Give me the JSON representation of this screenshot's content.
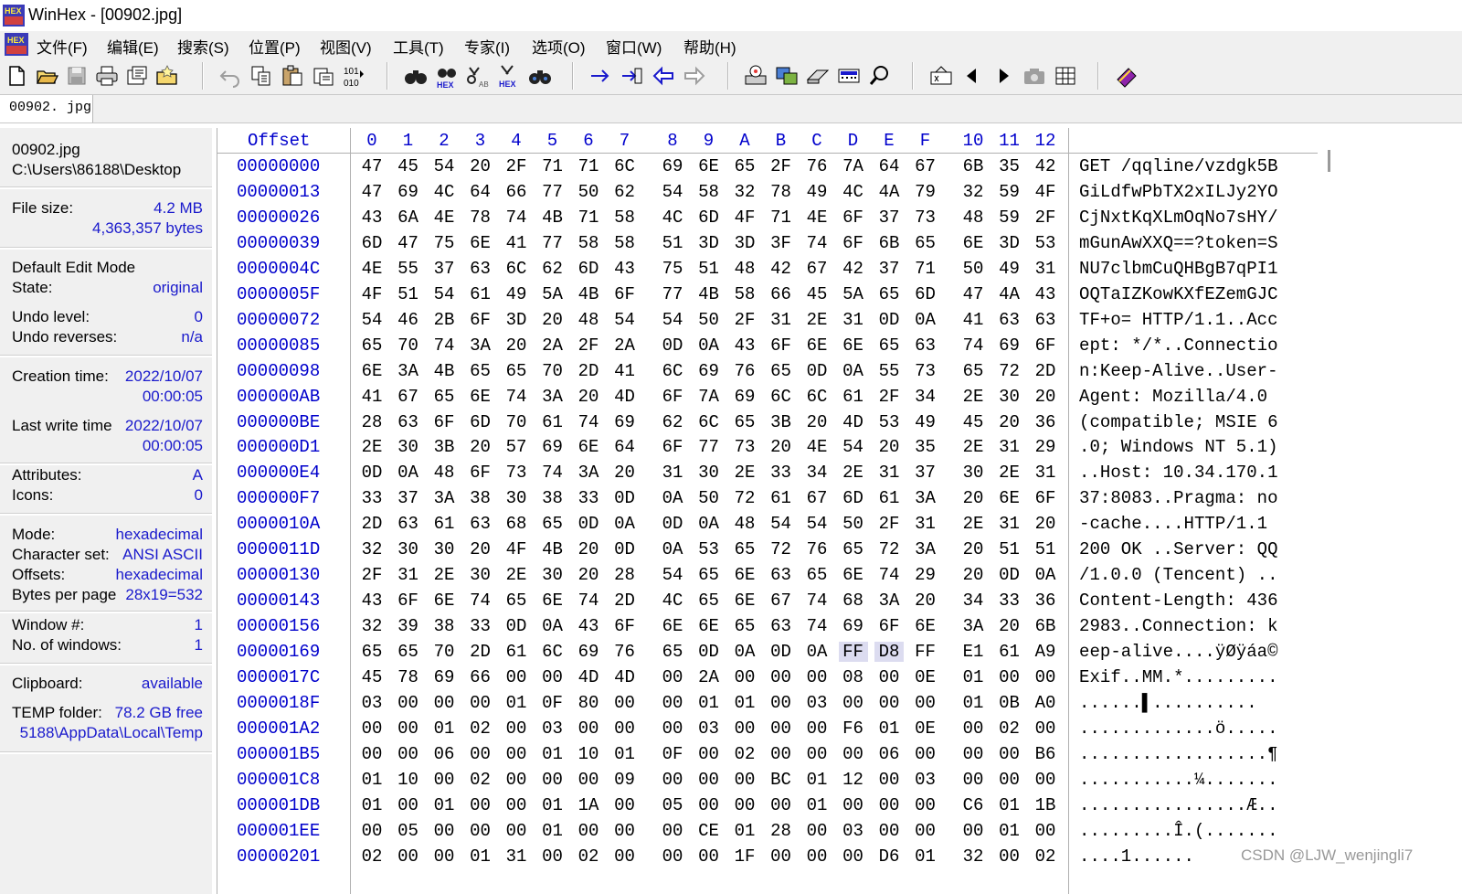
{
  "window": {
    "title": "WinHex - [00902.jpg]"
  },
  "menu": [
    "文件(F)",
    "编辑(E)",
    "搜索(S)",
    "位置(P)",
    "视图(V)",
    "工具(T)",
    "专家(I)",
    "选项(O)",
    "窗口(W)",
    "帮助(H)"
  ],
  "toolbar_icons": [
    "new-file-icon",
    "open-file-icon",
    "save-icon",
    "print-icon",
    "properties-icon",
    "open-folder-icon",
    "undo-icon",
    "copy-icon",
    "paste-icon",
    "clipboard-icon",
    "binary-icon",
    "find-text-icon",
    "find-hex-icon",
    "replace-text-icon",
    "replace-hex-icon",
    "find-again-icon",
    "goto-offset-icon",
    "goto-position-icon",
    "back-icon",
    "forward-icon",
    "disk-editor-icon",
    "ram-editor-icon",
    "disk-icon",
    "calculator-icon",
    "zoom-search-icon",
    "record-presentation-icon",
    "previous-icon",
    "next-icon",
    "camera-icon",
    "grid-view-icon",
    "help-book-icon"
  ],
  "tab": {
    "label": "00902. jpg"
  },
  "info": {
    "filename": "00902.jpg",
    "path": "C:\\Users\\86188\\Desktop",
    "file_size_label": "File size:",
    "file_size_mb": "4.2 MB",
    "file_size_bytes": "4,363,357 bytes",
    "edit_mode_label": "Default Edit Mode",
    "state_label": "State:",
    "state_value": "original",
    "undo_level_label": "Undo level:",
    "undo_level_value": "0",
    "undo_reverses_label": "Undo reverses:",
    "undo_reverses_value": "n/a",
    "creation_label": "Creation time:",
    "creation_date": "2022/10/07",
    "creation_time": "00:00:05",
    "lastwrite_label": "Last write time",
    "lastwrite_date": "2022/10/07",
    "lastwrite_time": "00:00:05",
    "attributes_label": "Attributes:",
    "attributes_value": "A",
    "icons_label": "Icons:",
    "icons_value": "0",
    "mode_label": "Mode:",
    "mode_value": "hexadecimal",
    "charset_label": "Character set:",
    "charset_value": "ANSI ASCII",
    "offsets_label": "Offsets:",
    "offsets_value": "hexadecimal",
    "bpp_label": "Bytes per page",
    "bpp_value": "28x19=532",
    "window_no_label": "Window #:",
    "window_no_value": "1",
    "windows_count_label": "No. of windows:",
    "windows_count_value": "1",
    "clipboard_label": "Clipboard:",
    "clipboard_value": "available",
    "temp_label": "TEMP folder:",
    "temp_value": "78.2 GB free",
    "temp_path": "5188\\AppData\\Local\\Temp"
  },
  "hex": {
    "offset_header": "Offset",
    "columns": [
      "0",
      "1",
      "2",
      "3",
      "4",
      "5",
      "6",
      "7",
      "8",
      "9",
      "A",
      "B",
      "C",
      "D",
      "E",
      "F",
      "10",
      "11",
      "12"
    ],
    "rows": [
      {
        "offset": "00000000",
        "bytes": [
          "47",
          "45",
          "54",
          "20",
          "2F",
          "71",
          "71",
          "6C",
          "69",
          "6E",
          "65",
          "2F",
          "76",
          "7A",
          "64",
          "67",
          "6B",
          "35",
          "42"
        ],
        "text": "GET /qqline/vzdgk5B"
      },
      {
        "offset": "00000013",
        "bytes": [
          "47",
          "69",
          "4C",
          "64",
          "66",
          "77",
          "50",
          "62",
          "54",
          "58",
          "32",
          "78",
          "49",
          "4C",
          "4A",
          "79",
          "32",
          "59",
          "4F"
        ],
        "text": "GiLdfwPbTX2xILJy2YO"
      },
      {
        "offset": "00000026",
        "bytes": [
          "43",
          "6A",
          "4E",
          "78",
          "74",
          "4B",
          "71",
          "58",
          "4C",
          "6D",
          "4F",
          "71",
          "4E",
          "6F",
          "37",
          "73",
          "48",
          "59",
          "2F"
        ],
        "text": "CjNxtKqXLmOqNo7sHY/"
      },
      {
        "offset": "00000039",
        "bytes": [
          "6D",
          "47",
          "75",
          "6E",
          "41",
          "77",
          "58",
          "58",
          "51",
          "3D",
          "3D",
          "3F",
          "74",
          "6F",
          "6B",
          "65",
          "6E",
          "3D",
          "53"
        ],
        "text": "mGunAwXXQ==?token=S"
      },
      {
        "offset": "0000004C",
        "bytes": [
          "4E",
          "55",
          "37",
          "63",
          "6C",
          "62",
          "6D",
          "43",
          "75",
          "51",
          "48",
          "42",
          "67",
          "42",
          "37",
          "71",
          "50",
          "49",
          "31"
        ],
        "text": "NU7clbmCuQHBgB7qPI1"
      },
      {
        "offset": "0000005F",
        "bytes": [
          "4F",
          "51",
          "54",
          "61",
          "49",
          "5A",
          "4B",
          "6F",
          "77",
          "4B",
          "58",
          "66",
          "45",
          "5A",
          "65",
          "6D",
          "47",
          "4A",
          "43"
        ],
        "text": "OQTaIZKowKXfEZemGJC"
      },
      {
        "offset": "00000072",
        "bytes": [
          "54",
          "46",
          "2B",
          "6F",
          "3D",
          "20",
          "48",
          "54",
          "54",
          "50",
          "2F",
          "31",
          "2E",
          "31",
          "0D",
          "0A",
          "41",
          "63",
          "63"
        ],
        "text": "TF+o= HTTP/1.1..Acc"
      },
      {
        "offset": "00000085",
        "bytes": [
          "65",
          "70",
          "74",
          "3A",
          "20",
          "2A",
          "2F",
          "2A",
          "0D",
          "0A",
          "43",
          "6F",
          "6E",
          "6E",
          "65",
          "63",
          "74",
          "69",
          "6F"
        ],
        "text": "ept: */*..Connectio"
      },
      {
        "offset": "00000098",
        "bytes": [
          "6E",
          "3A",
          "4B",
          "65",
          "65",
          "70",
          "2D",
          "41",
          "6C",
          "69",
          "76",
          "65",
          "0D",
          "0A",
          "55",
          "73",
          "65",
          "72",
          "2D"
        ],
        "text": "n:Keep-Alive..User-"
      },
      {
        "offset": "000000AB",
        "bytes": [
          "41",
          "67",
          "65",
          "6E",
          "74",
          "3A",
          "20",
          "4D",
          "6F",
          "7A",
          "69",
          "6C",
          "6C",
          "61",
          "2F",
          "34",
          "2E",
          "30",
          "20"
        ],
        "text": "Agent: Mozilla/4.0 "
      },
      {
        "offset": "000000BE",
        "bytes": [
          "28",
          "63",
          "6F",
          "6D",
          "70",
          "61",
          "74",
          "69",
          "62",
          "6C",
          "65",
          "3B",
          "20",
          "4D",
          "53",
          "49",
          "45",
          "20",
          "36"
        ],
        "text": "(compatible; MSIE 6"
      },
      {
        "offset": "000000D1",
        "bytes": [
          "2E",
          "30",
          "3B",
          "20",
          "57",
          "69",
          "6E",
          "64",
          "6F",
          "77",
          "73",
          "20",
          "4E",
          "54",
          "20",
          "35",
          "2E",
          "31",
          "29"
        ],
        "text": ".0; Windows NT 5.1)"
      },
      {
        "offset": "000000E4",
        "bytes": [
          "0D",
          "0A",
          "48",
          "6F",
          "73",
          "74",
          "3A",
          "20",
          "31",
          "30",
          "2E",
          "33",
          "34",
          "2E",
          "31",
          "37",
          "30",
          "2E",
          "31"
        ],
        "text": "..Host: 10.34.170.1"
      },
      {
        "offset": "000000F7",
        "bytes": [
          "33",
          "37",
          "3A",
          "38",
          "30",
          "38",
          "33",
          "0D",
          "0A",
          "50",
          "72",
          "61",
          "67",
          "6D",
          "61",
          "3A",
          "20",
          "6E",
          "6F"
        ],
        "text": "37:8083..Pragma: no"
      },
      {
        "offset": "0000010A",
        "bytes": [
          "2D",
          "63",
          "61",
          "63",
          "68",
          "65",
          "0D",
          "0A",
          "0D",
          "0A",
          "48",
          "54",
          "54",
          "50",
          "2F",
          "31",
          "2E",
          "31",
          "20"
        ],
        "text": "-cache....HTTP/1.1 "
      },
      {
        "offset": "0000011D",
        "bytes": [
          "32",
          "30",
          "30",
          "20",
          "4F",
          "4B",
          "20",
          "0D",
          "0A",
          "53",
          "65",
          "72",
          "76",
          "65",
          "72",
          "3A",
          "20",
          "51",
          "51"
        ],
        "text": "200 OK ..Server: QQ"
      },
      {
        "offset": "00000130",
        "bytes": [
          "2F",
          "31",
          "2E",
          "30",
          "2E",
          "30",
          "20",
          "28",
          "54",
          "65",
          "6E",
          "63",
          "65",
          "6E",
          "74",
          "29",
          "20",
          "0D",
          "0A"
        ],
        "text": "/1.0.0 (Tencent) .."
      },
      {
        "offset": "00000143",
        "bytes": [
          "43",
          "6F",
          "6E",
          "74",
          "65",
          "6E",
          "74",
          "2D",
          "4C",
          "65",
          "6E",
          "67",
          "74",
          "68",
          "3A",
          "20",
          "34",
          "33",
          "36"
        ],
        "text": "Content-Length: 436"
      },
      {
        "offset": "00000156",
        "bytes": [
          "32",
          "39",
          "38",
          "33",
          "0D",
          "0A",
          "43",
          "6F",
          "6E",
          "6E",
          "65",
          "63",
          "74",
          "69",
          "6F",
          "6E",
          "3A",
          "20",
          "6B"
        ],
        "text": "2983..Connection: k"
      },
      {
        "offset": "00000169",
        "bytes": [
          "65",
          "65",
          "70",
          "2D",
          "61",
          "6C",
          "69",
          "76",
          "65",
          "0D",
          "0A",
          "0D",
          "0A",
          "FF",
          "D8",
          "FF",
          "E1",
          "61",
          "A9"
        ],
        "text": "eep-alive....ÿØÿáa©",
        "selected": [
          13,
          14
        ]
      },
      {
        "offset": "0000017C",
        "bytes": [
          "45",
          "78",
          "69",
          "66",
          "00",
          "00",
          "4D",
          "4D",
          "00",
          "2A",
          "00",
          "00",
          "00",
          "08",
          "00",
          "0E",
          "01",
          "00",
          "00"
        ],
        "text": "Exif..MM.*........."
      },
      {
        "offset": "0000018F",
        "bytes": [
          "03",
          "00",
          "00",
          "00",
          "01",
          "0F",
          "80",
          "00",
          "00",
          "01",
          "01",
          "00",
          "03",
          "00",
          "00",
          "00",
          "01",
          "0B",
          "A0"
        ],
        "text": "......▌.......... "
      },
      {
        "offset": "000001A2",
        "bytes": [
          "00",
          "00",
          "01",
          "02",
          "00",
          "03",
          "00",
          "00",
          "00",
          "03",
          "00",
          "00",
          "00",
          "F6",
          "01",
          "0E",
          "00",
          "02",
          "00"
        ],
        "text": ".............ö....."
      },
      {
        "offset": "000001B5",
        "bytes": [
          "00",
          "00",
          "06",
          "00",
          "00",
          "01",
          "10",
          "01",
          "0F",
          "00",
          "02",
          "00",
          "00",
          "00",
          "06",
          "00",
          "00",
          "00",
          "B6"
        ],
        "text": "..................¶"
      },
      {
        "offset": "000001C8",
        "bytes": [
          "01",
          "10",
          "00",
          "02",
          "00",
          "00",
          "00",
          "09",
          "00",
          "00",
          "00",
          "BC",
          "01",
          "12",
          "00",
          "03",
          "00",
          "00",
          "00"
        ],
        "text": "...........¼......."
      },
      {
        "offset": "000001DB",
        "bytes": [
          "01",
          "00",
          "01",
          "00",
          "00",
          "01",
          "1A",
          "00",
          "05",
          "00",
          "00",
          "00",
          "01",
          "00",
          "00",
          "00",
          "C6",
          "01",
          "1B"
        ],
        "text": "................Æ.."
      },
      {
        "offset": "000001EE",
        "bytes": [
          "00",
          "05",
          "00",
          "00",
          "00",
          "01",
          "00",
          "00",
          "00",
          "CE",
          "01",
          "28",
          "00",
          "03",
          "00",
          "00",
          "00",
          "01",
          "00"
        ],
        "text": ".........Î.(......."
      },
      {
        "offset": "00000201",
        "bytes": [
          "02",
          "00",
          "00",
          "01",
          "31",
          "00",
          "02",
          "00",
          "00",
          "00",
          "1F",
          "00",
          "00",
          "00",
          "D6",
          "01",
          "32",
          "00",
          "02"
        ],
        "text": "....1...... "
      }
    ]
  },
  "watermark": "CSDN @LJW_wenjingli7"
}
